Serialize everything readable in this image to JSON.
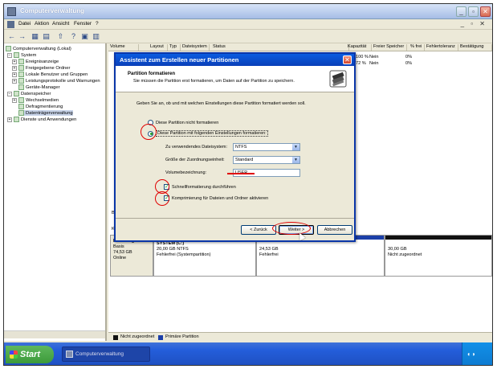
{
  "window": {
    "title": "Computerverwaltung"
  },
  "menubar": {
    "items": [
      "Datei",
      "Aktion",
      "Ansicht",
      "Fenster",
      "?"
    ],
    "doc_controls": "_ ▫ ✕"
  },
  "toolbar": {
    "buttons": [
      "←",
      "→",
      "▦",
      "▤",
      "⇧",
      "?",
      "▣",
      "▥"
    ]
  },
  "tree": {
    "items": [
      {
        "label": "Computerverwaltung (Lokal)",
        "expander": ""
      },
      {
        "label": "System",
        "expander": "−"
      },
      {
        "label": "Ereignisanzeige",
        "expander": "+"
      },
      {
        "label": "Freigegebene Ordner",
        "expander": "+"
      },
      {
        "label": "Lokale Benutzer und Gruppen",
        "expander": "+"
      },
      {
        "label": "Leistungsprotokolle und Warnungen",
        "expander": "+"
      },
      {
        "label": "Geräte-Manager",
        "expander": ""
      },
      {
        "label": "Datenspeicher",
        "expander": "−"
      },
      {
        "label": "Wechselmedien",
        "expander": "+"
      },
      {
        "label": "Defragmentierung",
        "expander": ""
      },
      {
        "label": "Datenträgerverwaltung",
        "expander": ""
      },
      {
        "label": "Dienste und Anwendungen",
        "expander": "+"
      }
    ]
  },
  "volume_list": {
    "columns": [
      "Volume",
      "Layout",
      "Typ",
      "Dateisystem",
      "Status",
      "Kapazität",
      "Freier Speicher",
      "% frei",
      "Fehlertoleranz",
      "Bestätigung"
    ],
    "rows": [
      {
        "pct_free": "100 %",
        "fault_tolerance": "Nein",
        "overhead": "0%"
      },
      {
        "pct_free": "72 %",
        "fault_tolerance": "Nein",
        "overhead": "0%"
      }
    ]
  },
  "disk": {
    "name": "Datenträger 0",
    "type": "Basis",
    "size": "74,53 GB",
    "state": "Online",
    "partitions": [
      {
        "name": "SYSTEM (C:)",
        "size": "20,00 GB NTFS",
        "status": "Fehlerfrei (Systempartition)",
        "bar_color": "#1c3fa8"
      },
      {
        "name": "",
        "size": "24,53 GB",
        "status": "Fehlerfrei",
        "bar_color": "#1c3fa8"
      },
      {
        "name": "",
        "size": "30,00 GB",
        "status": "Nicht zugeordnet",
        "bar_color": "#111111"
      }
    ],
    "left_labels": [
      "B",
      "K"
    ]
  },
  "legend": [
    {
      "label": "Nicht zugeordnet",
      "color": "#111111"
    },
    {
      "label": "Primäre Partition",
      "color": "#1c3fa8"
    }
  ],
  "wizard": {
    "title": "Assistent zum Erstellen neuer Partitionen",
    "heading": "Partition formatieren",
    "subheading": "Sie müssen die Partition erst formatieren, um Daten auf der Partition zu speichern.",
    "instruction": "Geben Sie an, ob und mit welchen Einstellungen diese Partition formatiert werden soll.",
    "option_no_format": "Diese Partition nicht formatieren",
    "option_format": "Diese Partition mit folgenden Einstellungen formatieren:",
    "fs_label": "Zu verwendendes Dateisystem:",
    "fs_value": "NTFS",
    "cluster_label": "Größe der Zuordnungseinheit:",
    "cluster_value": "Standard",
    "volume_label_label": "Volumebezeichnung:",
    "volume_label_value": "USER",
    "quick_format_label": "Schnellformatierung durchführen",
    "compression_label": "Komprimierung für Dateien und Ordner aktivieren",
    "back_button": "< Zurück",
    "next_button": "Weiter >",
    "cancel_button": "Abbrechen",
    "selected_option": "format",
    "quick_format_checked": true,
    "compression_checked": true
  },
  "taskbar": {
    "start_label": "Start",
    "task_label": "Computerverwaltung",
    "tray_icons": "◐◑"
  },
  "colors": {
    "annotation": "#e00000",
    "title_blue": "#0a3fb8"
  }
}
